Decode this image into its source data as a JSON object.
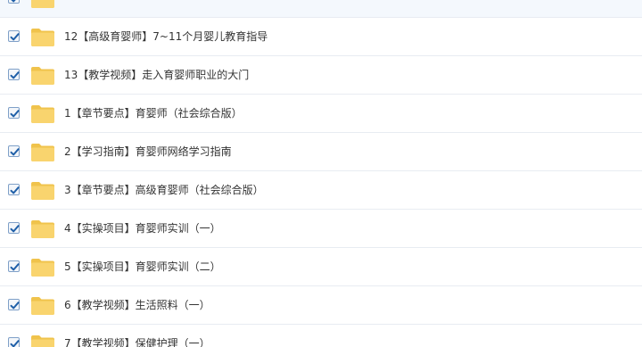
{
  "files": [
    {
      "label": "",
      "checked": true
    },
    {
      "label": "12【高级育婴师】7~11个月婴儿教育指导",
      "checked": true
    },
    {
      "label": "13【教学视频】走入育婴师职业的大门",
      "checked": true
    },
    {
      "label": "1【章节要点】育婴师（社会综合版）",
      "checked": true
    },
    {
      "label": "2【学习指南】育婴师网络学习指南",
      "checked": true
    },
    {
      "label": "3【章节要点】高级育婴师（社会综合版）",
      "checked": true
    },
    {
      "label": "4【实操项目】育婴师实训（一）",
      "checked": true
    },
    {
      "label": "5【实操项目】育婴师实训（二）",
      "checked": true
    },
    {
      "label": "6【教学视频】生活照料（一）",
      "checked": true
    },
    {
      "label": "7【教学视频】保健护理（一）",
      "checked": true
    }
  ],
  "icons": {
    "checkbox": "check-icon",
    "folder": "folder-icon"
  },
  "colors": {
    "folder_fill": "#f9d46e",
    "folder_back": "#f0c34c",
    "check": "#1f5fa8",
    "row_border": "#e8ecf2",
    "text": "#333333"
  }
}
